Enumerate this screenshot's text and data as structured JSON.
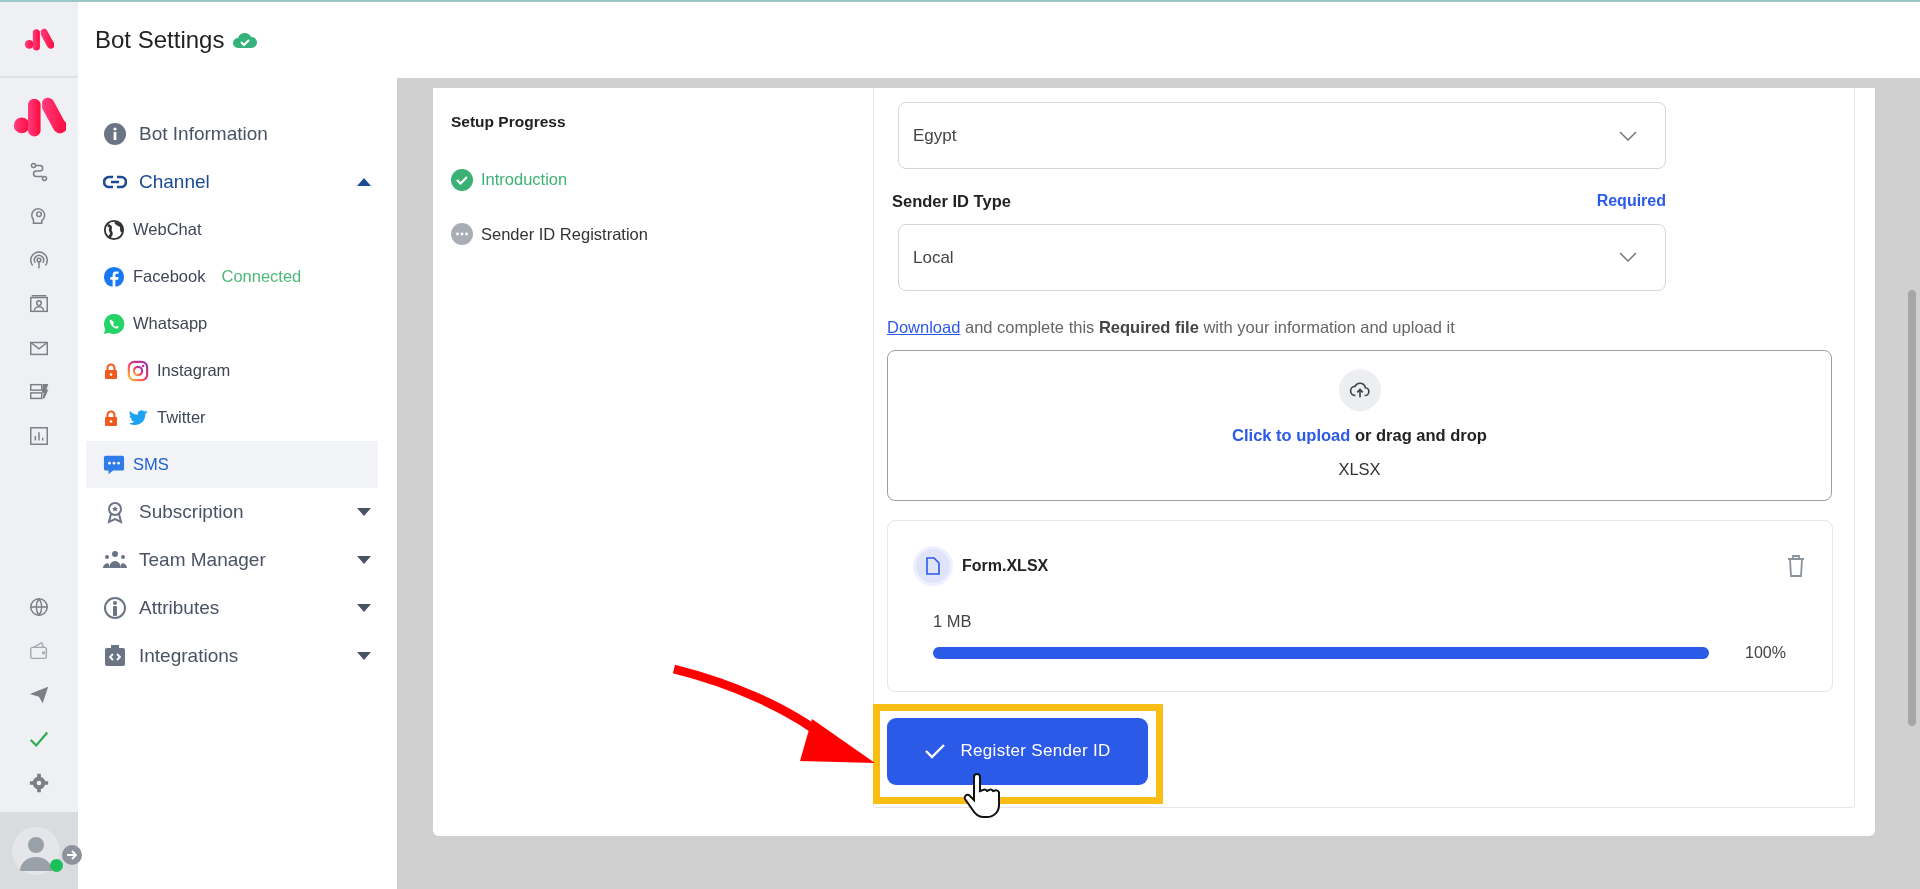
{
  "header": {
    "title": "Bot Settings",
    "saved": true
  },
  "user": {
    "online": true
  },
  "sidebar": {
    "items": [
      {
        "label": "Bot Information",
        "kind": "link",
        "selected": false
      },
      {
        "label": "Channel",
        "kind": "group",
        "selected": true,
        "expanded": true,
        "children": [
          {
            "label": "WebChat",
            "locked": false,
            "selected": false
          },
          {
            "label": "Facebook",
            "status": "Connected",
            "locked": false,
            "selected": false
          },
          {
            "label": "Whatsapp",
            "locked": false,
            "selected": false
          },
          {
            "label": "Instagram",
            "locked": true,
            "selected": false
          },
          {
            "label": "Twitter",
            "locked": true,
            "selected": false
          },
          {
            "label": "SMS",
            "locked": false,
            "selected": true
          }
        ]
      },
      {
        "label": "Subscription",
        "kind": "group",
        "selected": false,
        "expanded": false
      },
      {
        "label": "Team Manager",
        "kind": "group",
        "selected": false,
        "expanded": false
      },
      {
        "label": "Attributes",
        "kind": "group",
        "selected": false,
        "expanded": false
      },
      {
        "label": "Integrations",
        "kind": "group",
        "selected": false,
        "expanded": false
      }
    ]
  },
  "setup": {
    "title": "Setup Progress",
    "steps": [
      {
        "label": "Introduction",
        "done": true
      },
      {
        "label": "Sender ID Registration",
        "done": false
      }
    ]
  },
  "form": {
    "country": {
      "value": "Egypt"
    },
    "sender_type": {
      "label": "Sender ID Type",
      "required": "Required",
      "value": "Local"
    },
    "instruction": {
      "link": "Download",
      "text": "and complete this **Required file** with your information and upload it"
    },
    "upload": {
      "action": "Click to upload",
      "text": "or drag and drop",
      "formats": "XLSX"
    },
    "file": {
      "name": "Form.XLSX",
      "size": "1 MB",
      "level": 1,
      "percent": "100%"
    },
    "submit": {
      "label": "Register Sender ID",
      "highlighted": true
    }
  }
}
